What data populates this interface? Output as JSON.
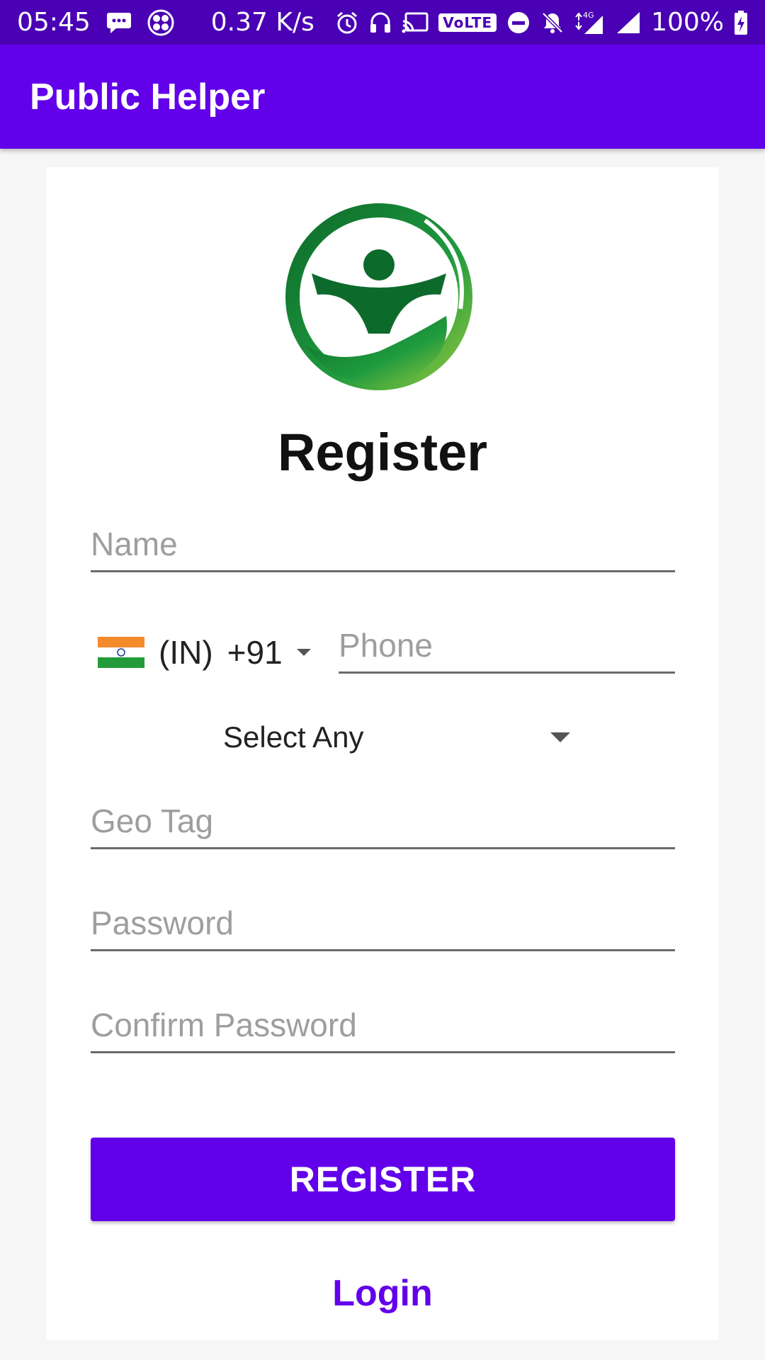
{
  "status_bar": {
    "time": "05:45",
    "net_speed": "0.37 K/s",
    "volte": "VoLTE",
    "network": "4G",
    "battery": "100%"
  },
  "app_bar": {
    "title": "Public Helper"
  },
  "form": {
    "heading": "Register",
    "name_placeholder": "Name",
    "country_code": "(IN)",
    "dial_code": "+91",
    "phone_placeholder": "Phone",
    "select_value": "Select Any",
    "geotag_placeholder": "Geo Tag",
    "password_placeholder": "Password",
    "confirm_password_placeholder": "Confirm Password",
    "register_label": "REGISTER",
    "login_label": "Login"
  },
  "colors": {
    "primary": "#6200ea",
    "status_bar": "#4a00b4",
    "logo_green": "#1e8a3a"
  }
}
